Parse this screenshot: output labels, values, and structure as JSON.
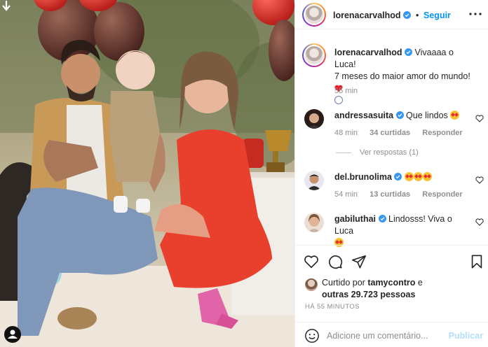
{
  "post": {
    "author": "lorenacarvalhod",
    "follow_label": "Seguir",
    "caption_line1": "Vivaaaa o Luca!",
    "caption_line2": "7 meses do maior amor do mundo!",
    "caption_time": "55 min"
  },
  "comments": [
    {
      "user": "andressasuita",
      "verified": true,
      "text": "Que lindos",
      "emoji": "star-struck",
      "time": "48 min",
      "likes": "34 curtidas",
      "reply": "Responder"
    },
    {
      "user": "del.brunolima",
      "verified": true,
      "text": "",
      "emoji": "star-struck x3",
      "time": "54 min",
      "likes": "13 curtidas",
      "reply": "Responder"
    },
    {
      "user": "gabiluthai",
      "verified": true,
      "text": "Lindosss! Viva o Luca",
      "emoji": "star-struck"
    }
  ],
  "view_replies": "Ver respostas (1)",
  "likes": {
    "prefix": "Curtido por",
    "user": "tamycontro",
    "conj": "e",
    "others": "outras 29.723 pessoas"
  },
  "timestamp": "HÁ 55 MINUTOS",
  "comment_box": {
    "placeholder": "Adicione um comentário...",
    "publish_label": "Publicar"
  },
  "icons": {
    "like": "heart-icon",
    "comment": "comment-icon",
    "share": "paper-plane-icon",
    "save": "bookmark-icon",
    "emoji": "smiley-icon",
    "more": "more-icon"
  },
  "colors": {
    "accent": "#0095f6",
    "muted": "#8e8e8e",
    "dress": "#e8402c",
    "publish_disabled": "#b2dffc"
  }
}
